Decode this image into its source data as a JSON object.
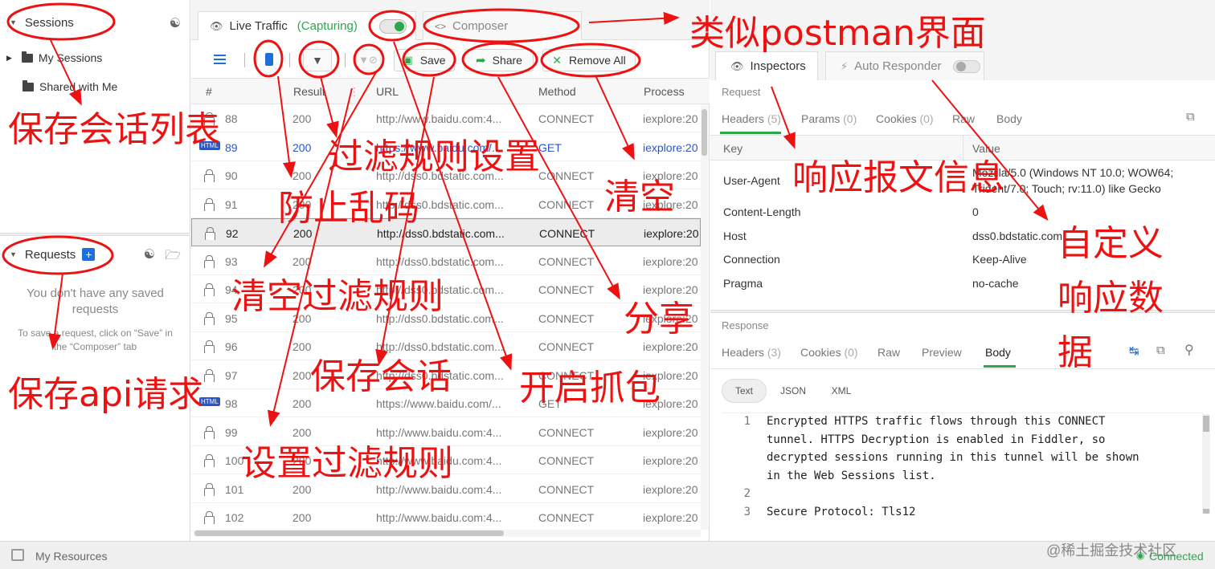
{
  "left_panel": {
    "sessions": {
      "title": "Sessions",
      "items": [
        "My Sessions",
        "Shared with Me"
      ]
    },
    "requests": {
      "title": "Requests",
      "empty_title": "You don't have any saved requests",
      "empty_hint": "To save a request, click on “Save” in the “Composer” tab"
    }
  },
  "middle_panel": {
    "tabs": {
      "live": "Live Traffic",
      "capturing": "(Capturing)",
      "composer": "Composer"
    },
    "toolbar": {
      "save": "Save",
      "share": "Share",
      "remove_all": "Remove All"
    },
    "columns": [
      "#",
      "Result",
      "URL",
      "Method",
      "Process"
    ],
    "rows": [
      {
        "id": "88",
        "result": "200",
        "url": "http://www.baidu.com:4...",
        "method": "CONNECT",
        "process": "iexplore:20"
      },
      {
        "id": "89",
        "result": "200",
        "url": "https://www.baidu.com/...",
        "method": "GET",
        "process": "iexplore:20"
      },
      {
        "id": "90",
        "result": "200",
        "url": "http://dss0.bdstatic.com...",
        "method": "CONNECT",
        "process": "iexplore:20"
      },
      {
        "id": "91",
        "result": "200",
        "url": "http://dss0.bdstatic.com...",
        "method": "CONNECT",
        "process": "iexplore:20"
      },
      {
        "id": "92",
        "result": "200",
        "url": "http://dss0.bdstatic.com...",
        "method": "CONNECT",
        "process": "iexplore:20"
      },
      {
        "id": "93",
        "result": "200",
        "url": "http://dss0.bdstatic.com...",
        "method": "CONNECT",
        "process": "iexplore:20"
      },
      {
        "id": "94",
        "result": "200",
        "url": "http://dss0.bdstatic.com...",
        "method": "CONNECT",
        "process": "iexplore:20"
      },
      {
        "id": "95",
        "result": "200",
        "url": "http://dss0.bdstatic.com...",
        "method": "CONNECT",
        "process": "iexplore:20"
      },
      {
        "id": "96",
        "result": "200",
        "url": "http://dss0.bdstatic.com...",
        "method": "CONNECT",
        "process": "iexplore:20"
      },
      {
        "id": "97",
        "result": "200",
        "url": "http://dss0.bdstatic.com...",
        "method": "CONNECT",
        "process": "iexplore:20"
      },
      {
        "id": "98",
        "result": "200",
        "url": "https://www.baidu.com/...",
        "method": "GET",
        "process": "iexplore:20"
      },
      {
        "id": "99",
        "result": "200",
        "url": "http://www.baidu.com:4...",
        "method": "CONNECT",
        "process": "iexplore:20"
      },
      {
        "id": "100",
        "result": "200",
        "url": "http://www.baidu.com:4...",
        "method": "CONNECT",
        "process": "iexplore:20"
      },
      {
        "id": "101",
        "result": "200",
        "url": "http://www.baidu.com:4...",
        "method": "CONNECT",
        "process": "iexplore:20"
      },
      {
        "id": "102",
        "result": "200",
        "url": "http://www.baidu.com:4...",
        "method": "CONNECT",
        "process": "iexplore:20"
      }
    ]
  },
  "right_panel": {
    "tabs": {
      "inspectors": "Inspectors",
      "auto_responder": "Auto Responder"
    },
    "request": {
      "section": "Request",
      "tabs": [
        {
          "label": "Headers",
          "count": "(5)"
        },
        {
          "label": "Params",
          "count": "(0)"
        },
        {
          "label": "Cookies",
          "count": "(0)"
        },
        {
          "label": "Raw",
          "count": ""
        },
        {
          "label": "Body",
          "count": ""
        }
      ],
      "key_header": "Key",
      "value_header": "Value",
      "headers": [
        {
          "key": "User-Agent",
          "value": "Mozilla/5.0 (Windows NT 10.0; WOW64;",
          "value2": "Trident/7.0; Touch; rv:11.0) like Gecko"
        },
        {
          "key": "Content-Length",
          "value": "0"
        },
        {
          "key": "Host",
          "value": "dss0.bdstatic.com"
        },
        {
          "key": "Connection",
          "value": "Keep-Alive"
        },
        {
          "key": "Pragma",
          "value": "no-cache"
        }
      ]
    },
    "response": {
      "section": "Response",
      "tabs": [
        {
          "label": "Headers",
          "count": "(3)"
        },
        {
          "label": "Cookies",
          "count": "(0)"
        },
        {
          "label": "Raw",
          "count": ""
        },
        {
          "label": "Preview",
          "count": ""
        },
        {
          "label": "Body",
          "count": ""
        }
      ],
      "formats": [
        "Text",
        "JSON",
        "XML"
      ],
      "lines": [
        {
          "n": "1",
          "t": "Encrypted HTTPS traffic flows through this CONNECT"
        },
        {
          "n": "",
          "t": "tunnel. HTTPS Decryption is enabled in Fiddler, so"
        },
        {
          "n": "",
          "t": "decrypted sessions running in this tunnel will be shown"
        },
        {
          "n": "",
          "t": "in the Web Sessions list."
        },
        {
          "n": "2",
          "t": ""
        },
        {
          "n": "3",
          "t": "Secure Protocol: Tls12"
        }
      ]
    }
  },
  "status_bar": {
    "my_resources": "My Resources",
    "connected": "Connected",
    "watermark": "@稀土掘金技术社区"
  },
  "annotations": {
    "postman": "类似postman界面",
    "session_list": "保存会话列表",
    "filter_settings": "过滤规则设置",
    "anti_garble": "防止乱码",
    "clear": "清空",
    "response_info": "响应报文信息",
    "custom_1": "自定义",
    "custom_2": "响应数",
    "custom_3": "据",
    "clear_filter": "清空过滤规则",
    "share": "分享",
    "save_session": "保存会话",
    "start_capture": "开启抓包",
    "save_api": "保存api请求",
    "set_filter": "设置过滤规则"
  },
  "colors": {
    "accent_green": "#2ba84a",
    "annotation_red": "#ee1111",
    "link_blue": "#2a55c9",
    "badge_blue": "#1e6fd9"
  }
}
